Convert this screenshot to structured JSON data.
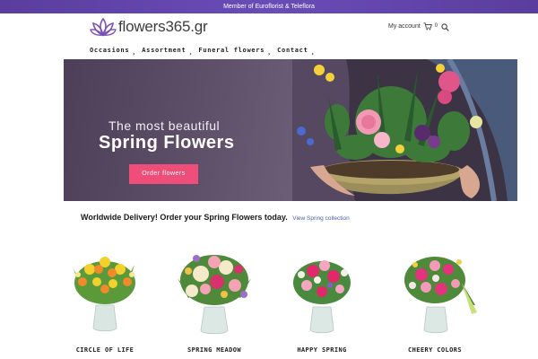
{
  "topbar": {
    "text": "Member of Euroflorist & Teleflora"
  },
  "header": {
    "logo_text": "flowers365.gr",
    "account_label": "My account",
    "cart_count": "0"
  },
  "nav": [
    {
      "label": "Occasions"
    },
    {
      "label": "Assortment"
    },
    {
      "label": "Funeral flowers"
    },
    {
      "label": "Contact"
    }
  ],
  "hero": {
    "subtitle": "The most beautiful",
    "title": "Spring Flowers",
    "button_label": "Order flowers"
  },
  "promo": {
    "text": "Worldwide Delivery! Order your Spring Flowers today.",
    "link_label": "View Spring collection"
  },
  "products": [
    {
      "name": "CIRCLE OF LIFE"
    },
    {
      "name": "SPRING MEADOW"
    },
    {
      "name": "HAPPY SPRING"
    },
    {
      "name": "CHEERY COLORS"
    }
  ],
  "colors": {
    "topbar": "#5a3d9e",
    "accent_button": "#f04e7a",
    "link": "#4a5fb0",
    "logo_mark": "#7b4fb8"
  }
}
